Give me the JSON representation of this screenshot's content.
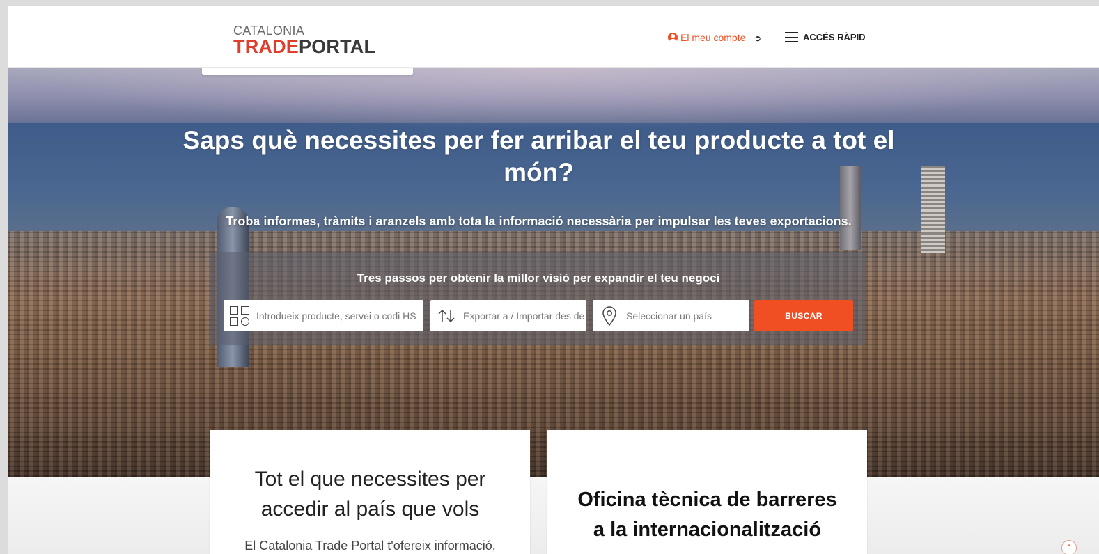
{
  "header": {
    "logo_top": "CATALONIA",
    "logo_trade": "TRADE",
    "logo_portal": "PORTAL",
    "account_label": "El meu compte",
    "quick_access_label": "ACCÉS RÀPID"
  },
  "hero": {
    "title": "Saps què necessites per fer arribar el teu producte a tot el món?",
    "subtitle": "Troba informes, tràmits i aranzels amb tota la informació necessària per impulsar les teves exportacions."
  },
  "search": {
    "title": "Tres passos per obtenir la millor visió per expandir el teu negoci",
    "product_placeholder": "Introdueix producte, servei o codi HS",
    "direction_placeholder": "Exportar a / Importar des de",
    "country_placeholder": "Seleccionar un país",
    "button_label": "BUSCAR"
  },
  "cards": {
    "card1_title": "Tot el que necessites per accedir al país que vols",
    "card1_text": "El Catalonia Trade Portal t'ofereix informació,",
    "card2_title": "Oficina tècnica de barreres a la internacionalització"
  },
  "colors": {
    "accent": "#f04e23",
    "logo_red": "#e03e2d",
    "logo_dark": "#3a3a3a"
  },
  "icons": {
    "account": "user-circle-icon",
    "logout": "logout-icon",
    "menu": "hamburger-icon",
    "product": "grid-icon",
    "direction": "arrows-icon",
    "country": "map-pin-icon",
    "scroll": "chevron-up-icon"
  }
}
